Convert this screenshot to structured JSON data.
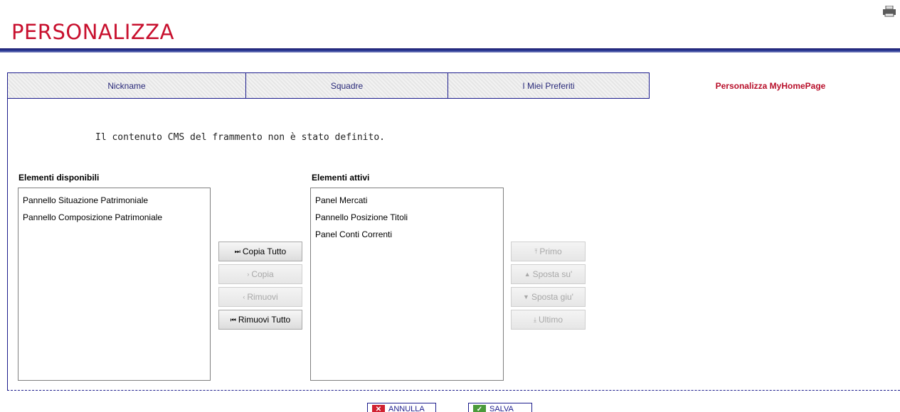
{
  "page": {
    "title": "PERSONALIZZA"
  },
  "tabs": [
    {
      "label": "Nickname",
      "active": false
    },
    {
      "label": "Squadre",
      "active": false
    },
    {
      "label": "I Miei Preferiti",
      "active": false
    },
    {
      "label": "Personalizza MyHomePage",
      "active": true
    }
  ],
  "message": "Il contenuto CMS del frammento non è stato definito.",
  "available": {
    "label": "Elementi disponibili",
    "items": [
      "Pannello Situazione Patrimoniale",
      "Pannello Composizione Patrimoniale"
    ]
  },
  "active": {
    "label": "Elementi attivi",
    "items": [
      "Panel Mercati",
      "Pannello Posizione Titoli",
      "Panel Conti Correnti"
    ]
  },
  "transfer_buttons": {
    "copy_all": {
      "label": "Copia Tutto",
      "glyph": "⏭",
      "enabled": true
    },
    "copy": {
      "label": "Copia",
      "glyph": "›",
      "enabled": false
    },
    "remove": {
      "label": "Rimuovi",
      "glyph": "‹",
      "enabled": false
    },
    "remove_all": {
      "label": "Rimuovi Tutto",
      "glyph": "⏮",
      "enabled": true
    }
  },
  "order_buttons": {
    "first": {
      "label": "Primo",
      "glyph": "⤒",
      "enabled": false
    },
    "up": {
      "label": "Sposta su'",
      "glyph": "▲",
      "enabled": false
    },
    "down": {
      "label": "Sposta giu'",
      "glyph": "▼",
      "enabled": false
    },
    "last": {
      "label": "Ultimo",
      "glyph": "⤓",
      "enabled": false
    }
  },
  "actions": {
    "cancel": "ANNULLA",
    "save": "SALVA"
  },
  "icons": {
    "print": "print-icon",
    "cancel": "cancel-x-icon",
    "save": "save-check-icon"
  },
  "colors": {
    "title": "#c8102e",
    "accent": "#1c1c8c",
    "active_tab": "#b80f2a"
  }
}
